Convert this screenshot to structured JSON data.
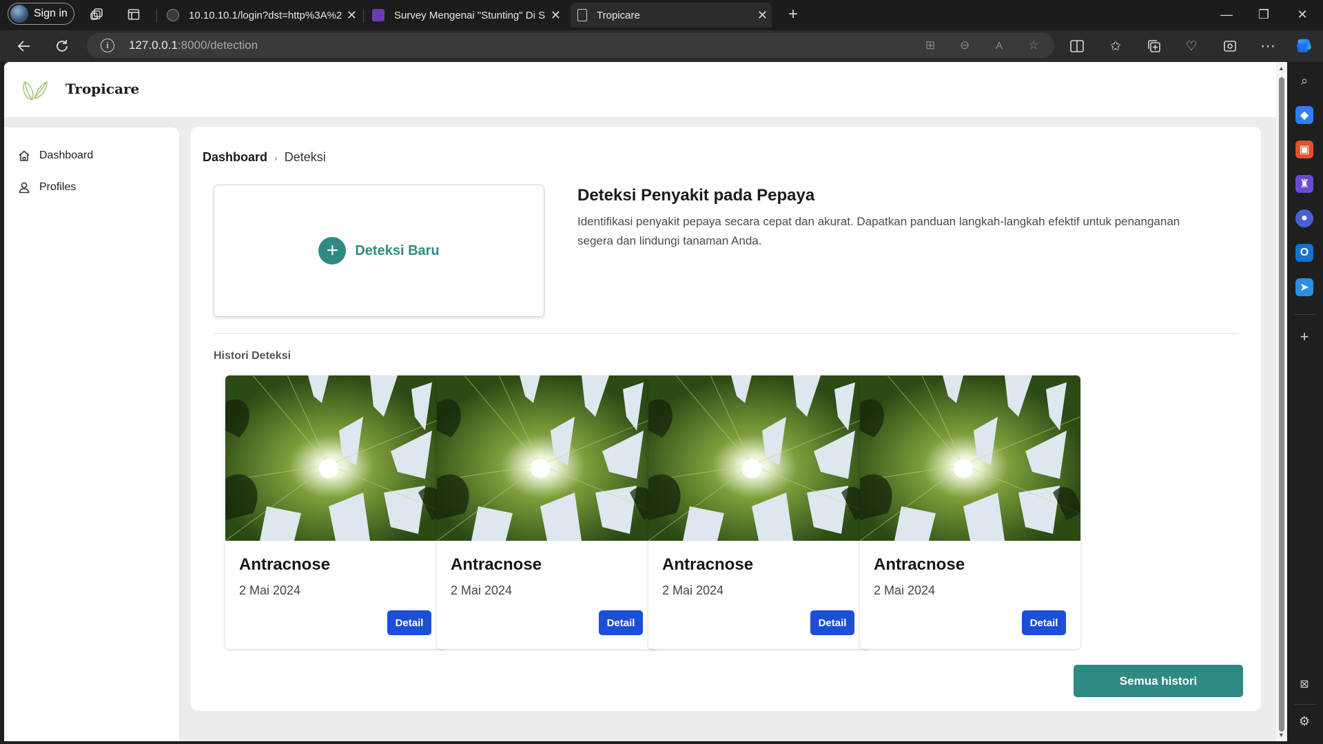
{
  "browser": {
    "signin_label": "Sign in",
    "tabs": [
      {
        "title": "10.10.10.1/login?dst=http%3A%2",
        "favicon": "globe-icon"
      },
      {
        "title": "Survey Mengenai \"Stunting\" Di S",
        "favicon": "form-icon"
      },
      {
        "title": "Tropicare",
        "favicon": "page-icon"
      }
    ],
    "new_tab": "+",
    "url_host": "127.0.0.1",
    "url_path": ":8000/detection"
  },
  "app": {
    "brand": "Tropicare",
    "accent": "#2f8a84",
    "button_blue": "#1a4fd6"
  },
  "sidebar": {
    "items": [
      {
        "label": "Dashboard",
        "icon": "home-icon"
      },
      {
        "label": "Profiles",
        "icon": "user-icon"
      }
    ]
  },
  "breadcrumb": {
    "root": "Dashboard",
    "separator": "›",
    "current": "Deteksi"
  },
  "new_detection": {
    "icon": "+",
    "label": "Deteksi Baru"
  },
  "intro": {
    "title": "Deteksi Penyakit pada Pepaya",
    "description": "Identifikasi penyakit pepaya secara cepat dan akurat. Dapatkan panduan langkah-langkah efektif untuk penanganan segera dan lindungi tanaman Anda."
  },
  "history": {
    "label": "Histori Deteksi",
    "cards": [
      {
        "disease": "Antracnose",
        "date": "2 Mai 2024",
        "button": "Detail"
      },
      {
        "disease": "Antracnose",
        "date": "2 Mai 2024",
        "button": "Detail"
      },
      {
        "disease": "Antracnose",
        "date": "2 Mai 2024",
        "button": "Detail"
      },
      {
        "disease": "Antracnose",
        "date": "2 Mai 2024",
        "button": "Detail"
      }
    ],
    "all_button": "Semua histori"
  }
}
